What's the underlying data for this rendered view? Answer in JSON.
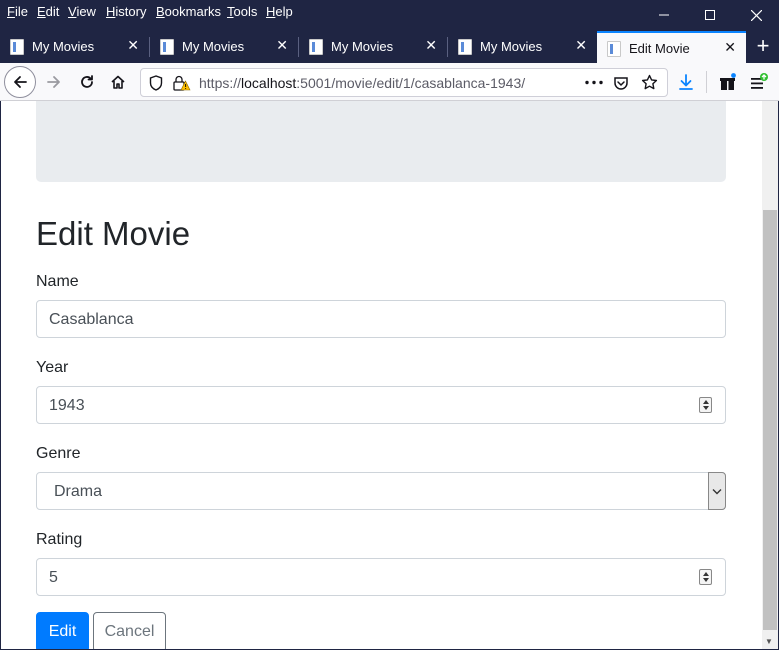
{
  "menu": [
    "File",
    "Edit",
    "View",
    "History",
    "Bookmarks",
    "Tools",
    "Help"
  ],
  "tabs": [
    {
      "title": "My Movies",
      "active": false
    },
    {
      "title": "My Movies",
      "active": false
    },
    {
      "title": "My Movies",
      "active": false
    },
    {
      "title": "My Movies",
      "active": false
    },
    {
      "title": "Edit Movie",
      "active": true
    }
  ],
  "tab_close": "✕",
  "new_tab": "+",
  "window_controls": {
    "minimize": "—",
    "maximize": "☐",
    "close": "✕"
  },
  "url": {
    "scheme": "https://",
    "host": "localhost",
    "path": ":5001/movie/edit/1/casablanca-1943/"
  },
  "page": {
    "title": "Edit Movie",
    "fields": {
      "name": {
        "label": "Name",
        "value": "Casablanca"
      },
      "year": {
        "label": "Year",
        "value": "1943"
      },
      "genre": {
        "label": "Genre",
        "value": "Drama"
      },
      "rating": {
        "label": "Rating",
        "value": "5"
      }
    },
    "buttons": {
      "edit": "Edit",
      "cancel": "Cancel"
    }
  },
  "colors": {
    "accent": "#0a84ff",
    "primary_button": "#007bff",
    "titlebar": "#1f2543"
  }
}
